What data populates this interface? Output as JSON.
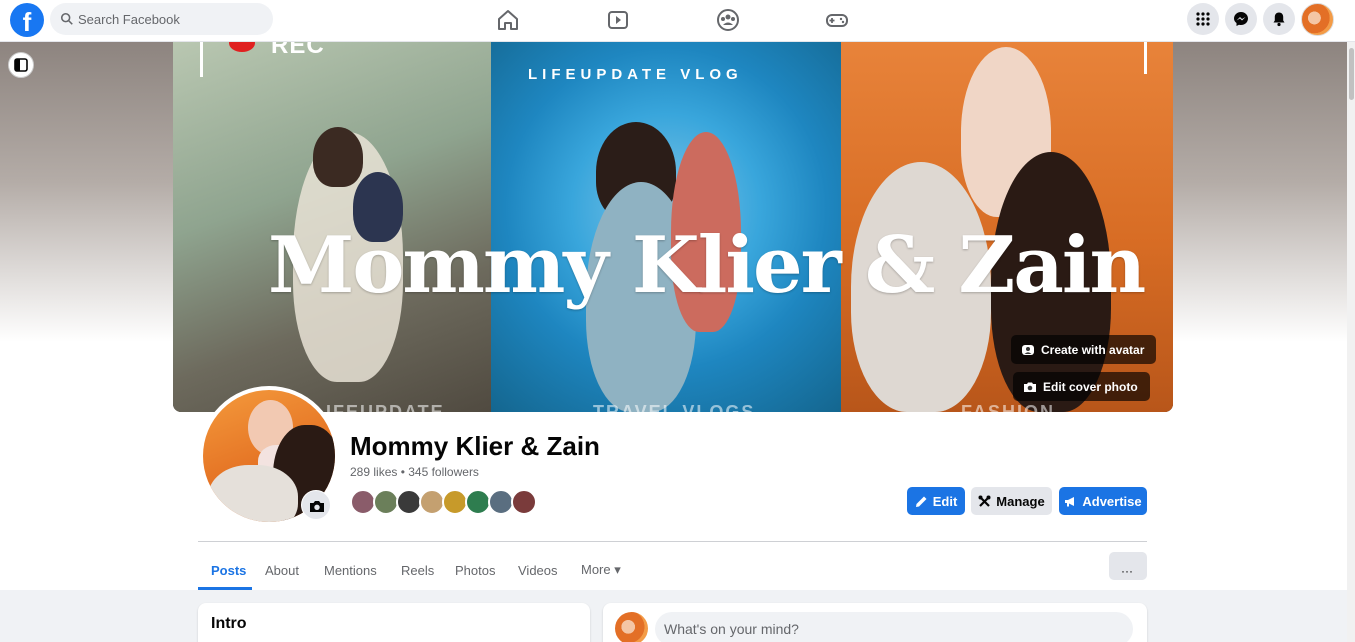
{
  "topbar": {
    "logo": "f",
    "search_placeholder": "Search Facebook",
    "nav_icons": [
      "home-icon",
      "video-icon",
      "groups-icon",
      "gaming-icon"
    ],
    "right_icons": [
      "menu-grid-icon",
      "messenger-icon",
      "notifications-icon"
    ]
  },
  "cover": {
    "title": "Mommy Klier & Zain",
    "rec": "REC",
    "arc_text": "LIFEUPDATE VLOG",
    "footer_labels": [
      "LIFEUPDATE",
      "TRAVEL VLOGS",
      "FASHION"
    ],
    "create_avatar_label": "Create with avatar",
    "edit_cover_label": "Edit cover photo"
  },
  "profile": {
    "name": "Mommy Klier & Zain",
    "stats": "289 likes • 345 followers",
    "friend_count_shown": 8
  },
  "actions": {
    "edit_label": "Edit",
    "manage_label": "Manage",
    "advertise_label": "Advertise"
  },
  "tabs": [
    {
      "label": "Posts",
      "active": true
    },
    {
      "label": "About",
      "active": false
    },
    {
      "label": "Mentions",
      "active": false
    },
    {
      "label": "Reels",
      "active": false
    },
    {
      "label": "Photos",
      "active": false
    },
    {
      "label": "Videos",
      "active": false
    },
    {
      "label": "More ▾",
      "active": false
    }
  ],
  "tabs_more_button": "···",
  "intro": {
    "title": "Intro"
  },
  "composer": {
    "placeholder": "What's on your mind?"
  },
  "colors": {
    "accent": "#1b74e4",
    "brand": "#1877f2",
    "page_bg": "#f0f2f5"
  }
}
